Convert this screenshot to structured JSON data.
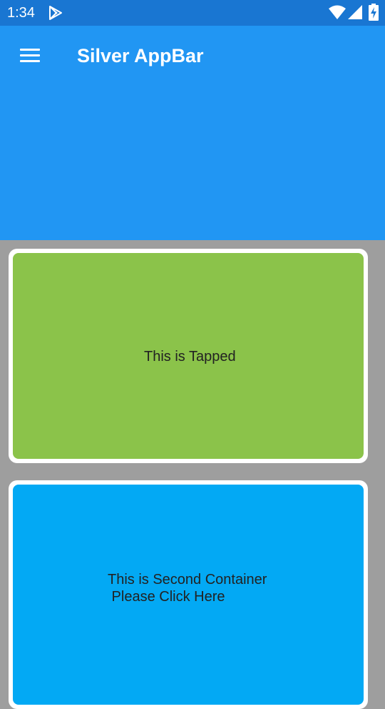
{
  "status_bar": {
    "time": "1:34",
    "icons": [
      "play-store-icon",
      "wifi-icon",
      "cell-signal-icon",
      "battery-charging-icon"
    ],
    "background": "#1976d2"
  },
  "app_bar": {
    "title": "Silver AppBar",
    "menu_icon": "menu-icon",
    "background": "#2196f3"
  },
  "cards": [
    {
      "text": "This is Tapped",
      "color": "#8bc34a"
    },
    {
      "text": "This is Second Container\n Please Click Here",
      "color": "#03a9f4"
    }
  ],
  "page_background": "#9e9e9e"
}
